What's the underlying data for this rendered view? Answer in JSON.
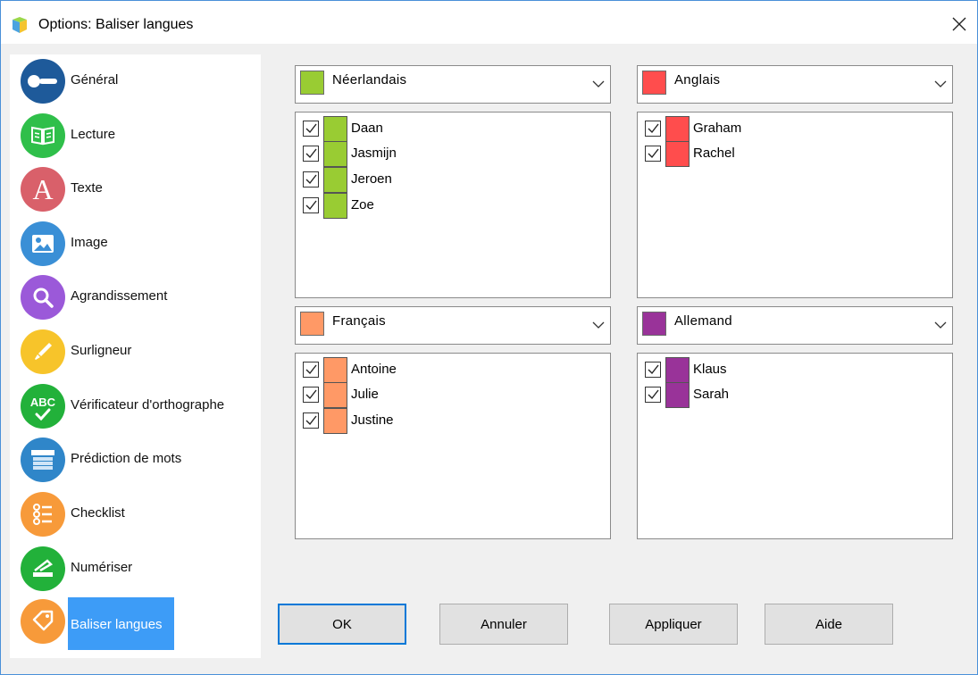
{
  "window": {
    "title": "Options: Baliser langues",
    "close_label": "✕"
  },
  "sidebar": {
    "items": [
      {
        "label": "Général",
        "icon": "toggle-icon",
        "color": "#1e5a9a"
      },
      {
        "label": "Lecture",
        "icon": "book-icon",
        "color": "#2fbf4a"
      },
      {
        "label": "Texte",
        "icon": "letter-a-icon",
        "color": "#d9606a",
        "glyph": "A"
      },
      {
        "label": "Image",
        "icon": "picture-icon",
        "color": "#3a8fd6"
      },
      {
        "label": "Agrandissement",
        "icon": "magnifier-icon",
        "color": "#9b59d9"
      },
      {
        "label": "Surligneur",
        "icon": "highlighter-icon",
        "color": "#f7c42a"
      },
      {
        "label": "Vérificateur d'orthographe",
        "icon": "spellcheck-icon",
        "color": "#22b13a",
        "glyph": "ABC"
      },
      {
        "label": "Prédiction de mots",
        "icon": "word-prediction-icon",
        "color": "#2f86c9"
      },
      {
        "label": "Checklist",
        "icon": "checklist-icon",
        "color": "#f79a3a"
      },
      {
        "label": "Numériser",
        "icon": "scanner-icon",
        "color": "#22b13a"
      },
      {
        "label": "Baliser langues",
        "icon": "language-tag-icon",
        "color": "#f79a3a",
        "active": true
      }
    ]
  },
  "languages": [
    {
      "name": "Néerlandais",
      "color": "#99cc33",
      "people": [
        "Daan",
        "Jasmijn",
        "Jeroen",
        "Zoe"
      ]
    },
    {
      "name": "Anglais",
      "color": "#ff4d4d",
      "people": [
        "Graham",
        "Rachel"
      ]
    },
    {
      "name": "Français",
      "color": "#ff9966",
      "people": [
        "Antoine",
        "Julie",
        "Justine"
      ]
    },
    {
      "name": "Allemand",
      "color": "#993399",
      "people": [
        "Klaus",
        "Sarah"
      ]
    }
  ],
  "buttons": {
    "ok": "OK",
    "cancel": "Annuler",
    "apply": "Appliquer",
    "help": "Aide"
  }
}
